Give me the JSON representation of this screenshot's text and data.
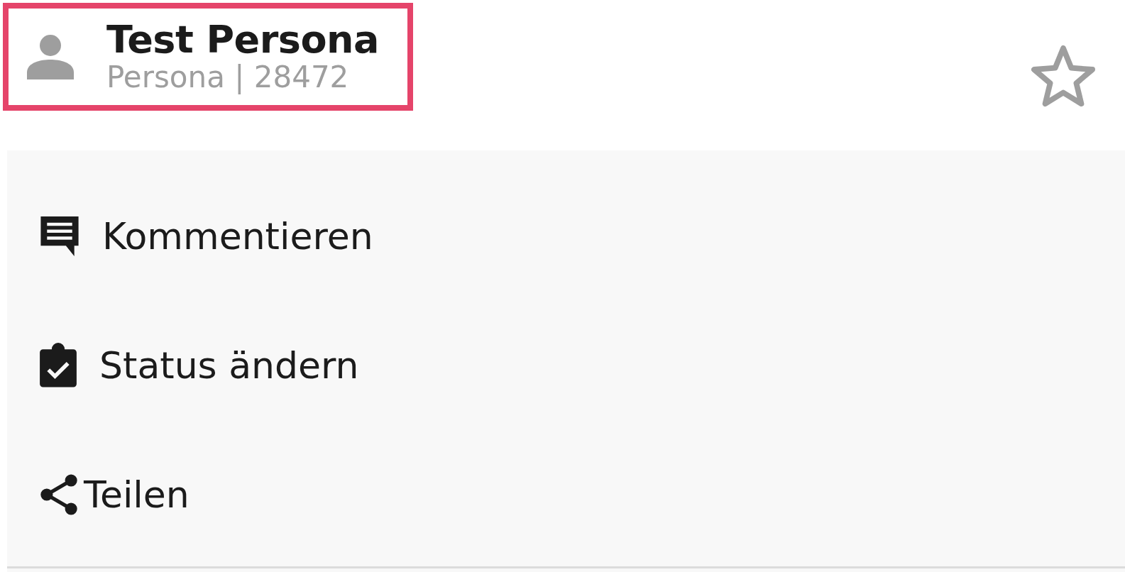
{
  "header": {
    "title": "Test Persona",
    "subtitle": "Persona | 28472",
    "highlighted": true,
    "favorite": false
  },
  "actions": [
    {
      "kind": "comment",
      "label": "Kommentieren"
    },
    {
      "kind": "status",
      "label": "Status ändern"
    },
    {
      "kind": "share",
      "label": "Teilen"
    }
  ]
}
